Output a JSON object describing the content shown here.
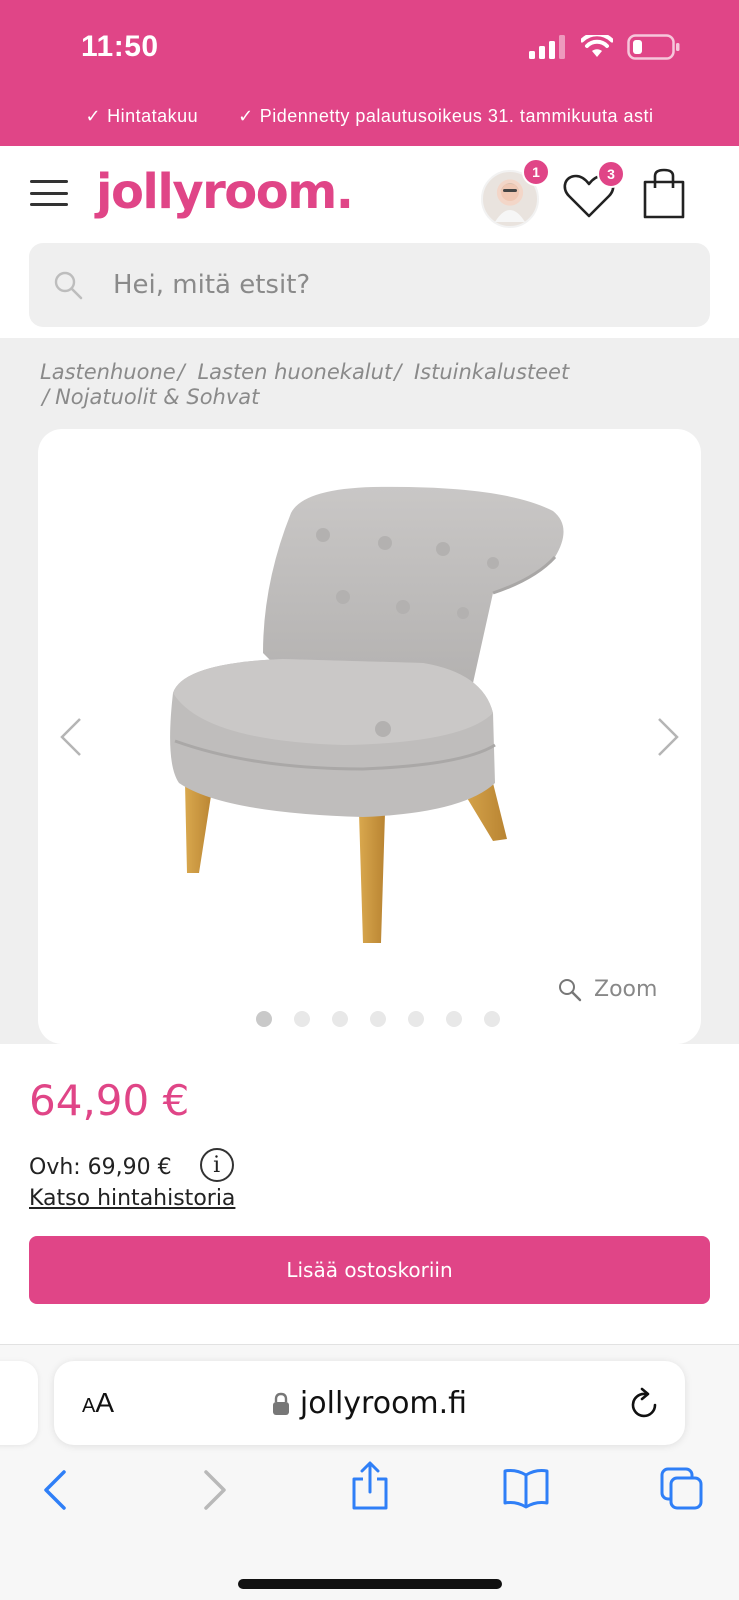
{
  "status": {
    "time": "11:50"
  },
  "promo": [
    {
      "label": "Hintatakuu"
    },
    {
      "label": "Pidennetty palautusoikeus 31. tammikuuta asti"
    }
  ],
  "header": {
    "logo": "jollyroom.",
    "profile_badge": "1",
    "wishlist_badge": "3"
  },
  "search": {
    "placeholder": "Hei, mitä etsit?"
  },
  "breadcrumb": {
    "items": [
      "Lastenhuone",
      "Lasten huonekalut",
      "Istuinkalusteet",
      "Nojatuolit & Sohvat"
    ]
  },
  "gallery": {
    "zoom_label": "Zoom",
    "image_count": 7,
    "active_index": 0
  },
  "product": {
    "price": "64,90 €",
    "ovh": "Ovh: 69,90 €",
    "info_label": "i",
    "price_history": "Katso hintahistoria",
    "add_to_cart": "Lisää ostoskoriin"
  },
  "browser": {
    "aa_small": "A",
    "aa_large": "A",
    "url": "jollyroom.fi"
  },
  "colors": {
    "brand": "#e04587",
    "ios_blue": "#2f7ff7"
  }
}
